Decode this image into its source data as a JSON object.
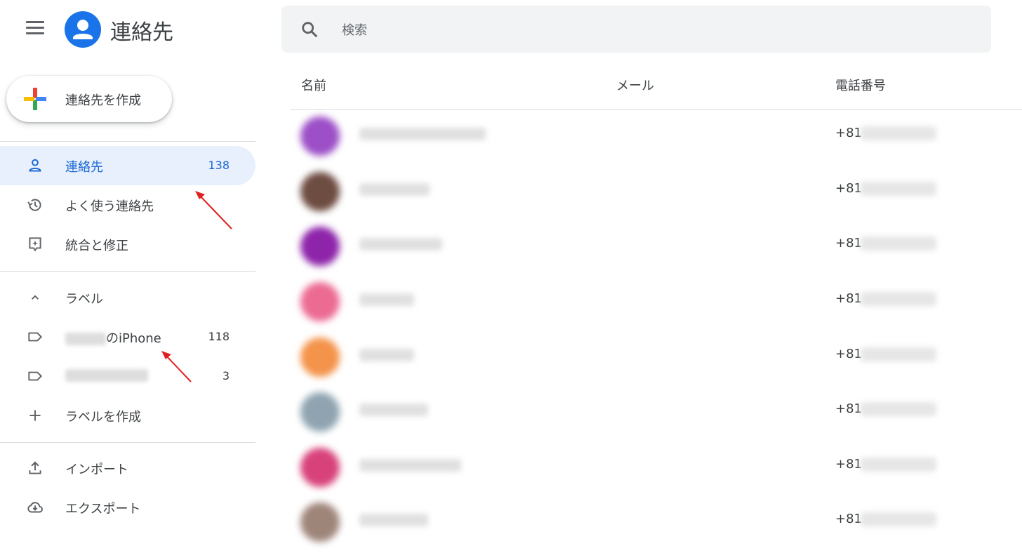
{
  "header": {
    "menu_icon": "hamburger-menu-icon",
    "app_title": "連絡先",
    "search_placeholder": "検索"
  },
  "create_button": {
    "label": "連絡先を作成"
  },
  "sidebar": {
    "items": [
      {
        "label": "連絡先",
        "count": "138",
        "icon": "person-icon",
        "active": true
      },
      {
        "label": "よく使う連絡先",
        "icon": "history-icon"
      },
      {
        "label": "統合と修正",
        "icon": "merge-fix-icon"
      }
    ],
    "labels_header": "ラベル",
    "labels": [
      {
        "label": "のiPhone",
        "count": "118",
        "icon": "label-icon"
      },
      {
        "label": "",
        "count": "3",
        "icon": "label-icon"
      }
    ],
    "create_label": "ラベルを作成",
    "import": "インポート",
    "export": "エクスポート"
  },
  "table": {
    "columns": [
      "名前",
      "メール",
      "電話番号"
    ],
    "rows": [
      {
        "avatar_color": "#9c4fc7",
        "phone_prefix": "+81"
      },
      {
        "avatar_color": "#6d4c41",
        "phone_prefix": "+81"
      },
      {
        "avatar_color": "#8e24aa",
        "phone_prefix": "+81"
      },
      {
        "avatar_color": "#ec6b93",
        "phone_prefix": "+81"
      },
      {
        "avatar_color": "#f4934a",
        "phone_prefix": "+81"
      },
      {
        "avatar_color": "#8fa4b0",
        "phone_prefix": "+81"
      },
      {
        "avatar_color": "#d8427a",
        "phone_prefix": "+81"
      },
      {
        "avatar_color": "#9e857a",
        "phone_prefix": "+81"
      }
    ]
  },
  "colors": {
    "accent": "#1a73e8",
    "active_bg": "#e8f0fe",
    "active_text": "#1967d2",
    "annotation_arrow": "#e02020"
  }
}
